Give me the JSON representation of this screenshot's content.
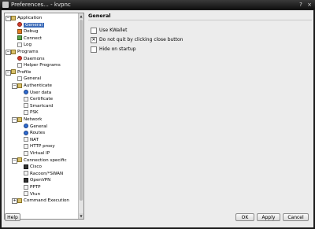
{
  "window": {
    "title": "Preferences... - kvpnc",
    "controls": [
      "?",
      "×"
    ]
  },
  "tree": [
    {
      "key": "application",
      "label": "Application",
      "level": 0,
      "exp": "−",
      "icon": "folder"
    },
    {
      "key": "general",
      "label": "General",
      "level": 1,
      "icon": "red",
      "selected": true
    },
    {
      "key": "debug",
      "label": "Debug",
      "level": 1,
      "icon": "orange"
    },
    {
      "key": "connect",
      "label": "Connect",
      "level": 1,
      "icon": "green"
    },
    {
      "key": "log",
      "label": "Log",
      "level": 1,
      "icon": "plain"
    },
    {
      "key": "programs",
      "label": "Programs",
      "level": 0,
      "exp": "−",
      "icon": "folder"
    },
    {
      "key": "daemons",
      "label": "Daemons",
      "level": 1,
      "icon": "red"
    },
    {
      "key": "helper",
      "label": "Helper Programs",
      "level": 1,
      "icon": "plain"
    },
    {
      "key": "profile",
      "label": "Profile",
      "level": 0,
      "exp": "−",
      "icon": "folder"
    },
    {
      "key": "profile-general",
      "label": "General",
      "level": 1,
      "icon": "plain"
    },
    {
      "key": "authenticate",
      "label": "Authenticate",
      "level": 1,
      "exp": "−",
      "icon": "folder"
    },
    {
      "key": "userdata",
      "label": "User data",
      "level": 2,
      "icon": "blue"
    },
    {
      "key": "certificate",
      "label": "Certificate",
      "level": 2,
      "icon": "plain"
    },
    {
      "key": "smartcard",
      "label": "Smartcard",
      "level": 2,
      "icon": "plain"
    },
    {
      "key": "psk",
      "label": "PSK",
      "level": 2,
      "icon": "plain"
    },
    {
      "key": "network",
      "label": "Network",
      "level": 1,
      "exp": "−",
      "icon": "folder"
    },
    {
      "key": "net-general",
      "label": "General",
      "level": 2,
      "icon": "blue"
    },
    {
      "key": "routes",
      "label": "Routes",
      "level": 2,
      "icon": "blue"
    },
    {
      "key": "nat",
      "label": "NAT",
      "level": 2,
      "icon": "plain"
    },
    {
      "key": "httpproxy",
      "label": "HTTP proxy",
      "level": 2,
      "icon": "plain"
    },
    {
      "key": "virtualip",
      "label": "Virtual IP",
      "level": 2,
      "icon": "plain"
    },
    {
      "key": "connspecific",
      "label": "Connection specific",
      "level": 1,
      "exp": "−",
      "icon": "folder"
    },
    {
      "key": "cisco",
      "label": "Cisco",
      "level": 2,
      "icon": "dark"
    },
    {
      "key": "racoon",
      "label": "Racoon/*SWAN",
      "level": 2,
      "icon": "plain"
    },
    {
      "key": "openvpn",
      "label": "OpenVPN",
      "level": 2,
      "icon": "dark"
    },
    {
      "key": "pptp",
      "label": "PPTP",
      "level": 2,
      "icon": "plain"
    },
    {
      "key": "vtun",
      "label": "Vtun",
      "level": 2,
      "icon": "plain"
    },
    {
      "key": "cmdexec",
      "label": "Command Execution",
      "level": 1,
      "exp": "+",
      "icon": "folder"
    }
  ],
  "panel": {
    "title": "General",
    "options": [
      {
        "key": "kwallet",
        "label": "Use KWallet",
        "checked": false
      },
      {
        "key": "noquit",
        "label": "Do not quit by clicking close button",
        "checked": true
      },
      {
        "key": "hide",
        "label": "Hide on startup",
        "checked": false
      }
    ]
  },
  "buttons": {
    "help": "Help",
    "ok": "OK",
    "apply": "Apply",
    "cancel": "Cancel"
  }
}
